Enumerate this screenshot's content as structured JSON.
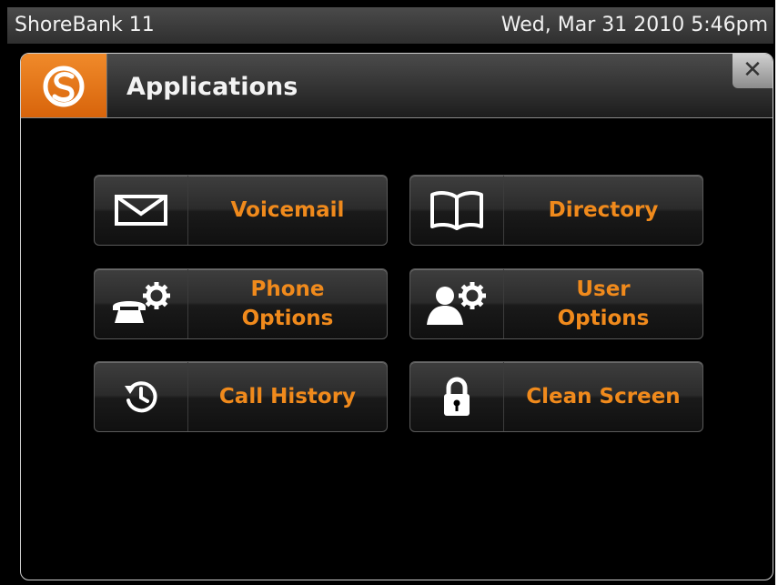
{
  "status_bar": {
    "extension_name": "ShoreBank 11",
    "datetime": "Wed, Mar 31 2010 5:46pm"
  },
  "window": {
    "title": "Applications",
    "close_glyph": "✕",
    "logo_icon": "shoretel-logo-icon"
  },
  "apps": [
    {
      "id": "voicemail",
      "label_line1": "Voicemail",
      "label_line2": "",
      "icon": "envelope-icon"
    },
    {
      "id": "directory",
      "label_line1": "Directory",
      "label_line2": "",
      "icon": "open-book-icon"
    },
    {
      "id": "phone-options",
      "label_line1": "Phone",
      "label_line2": "Options",
      "icon": "phone-gear-icon"
    },
    {
      "id": "user-options",
      "label_line1": "User",
      "label_line2": "Options",
      "icon": "user-gear-icon"
    },
    {
      "id": "call-history",
      "label_line1": "Call History",
      "label_line2": "",
      "icon": "clock-history-icon"
    },
    {
      "id": "clean-screen",
      "label_line1": "Clean Screen",
      "label_line2": "",
      "icon": "padlock-icon"
    }
  ],
  "colors": {
    "accent_orange": "#f08a1c",
    "logo_orange": "#e8761a",
    "background": "#000000"
  }
}
